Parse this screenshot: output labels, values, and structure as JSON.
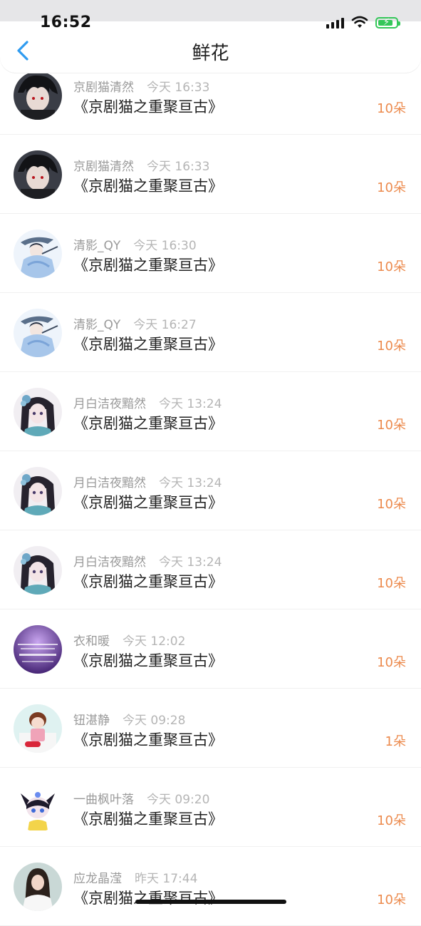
{
  "status_bar": {
    "time": "16:52"
  },
  "nav": {
    "title": "鲜花"
  },
  "colors": {
    "accent": "#ec8a4d",
    "back": "#2f9bf0",
    "battery": "#34c759"
  },
  "records": [
    {
      "name": "京剧猫清然",
      "time": "今天 16:33",
      "book": "《京剧猫之重聚亘古》",
      "amount": "10朵",
      "avatar": "dark-hair-avatar"
    },
    {
      "name": "京剧猫清然",
      "time": "今天 16:33",
      "book": "《京剧猫之重聚亘古》",
      "amount": "10朵",
      "avatar": "dark-hair-avatar"
    },
    {
      "name": "清影_QY",
      "time": "今天 16:30",
      "book": "《京剧猫之重聚亘古》",
      "amount": "10朵",
      "avatar": "blue-robe-avatar"
    },
    {
      "name": "清影_QY",
      "time": "今天 16:27",
      "book": "《京剧猫之重聚亘古》",
      "amount": "10朵",
      "avatar": "blue-robe-avatar"
    },
    {
      "name": "月白洁夜黯然",
      "time": "今天 13:24",
      "book": "《京剧猫之重聚亘古》",
      "amount": "10朵",
      "avatar": "flower-hair-avatar"
    },
    {
      "name": "月白洁夜黯然",
      "time": "今天 13:24",
      "book": "《京剧猫之重聚亘古》",
      "amount": "10朵",
      "avatar": "flower-hair-avatar"
    },
    {
      "name": "月白洁夜黯然",
      "time": "今天 13:24",
      "book": "《京剧猫之重聚亘古》",
      "amount": "10朵",
      "avatar": "flower-hair-avatar"
    },
    {
      "name": "衣和暖",
      "time": "今天 12:02",
      "book": "《京剧猫之重聚亘古》",
      "amount": "10朵",
      "avatar": "purple-text-avatar"
    },
    {
      "name": "钮湛静",
      "time": "今天 09:28",
      "book": "《京剧猫之重聚亘古》",
      "amount": "1朵",
      "avatar": "doll-avatar"
    },
    {
      "name": "一曲枫叶落",
      "time": "今天 09:20",
      "book": "《京剧猫之重聚亘古》",
      "amount": "10朵",
      "avatar": "cat-mask-avatar"
    },
    {
      "name": "应龙晶滢",
      "time": "昨天 17:44",
      "book": "《京剧猫之重聚亘古》",
      "amount": "10朵",
      "avatar": "girl-photo-avatar"
    }
  ]
}
